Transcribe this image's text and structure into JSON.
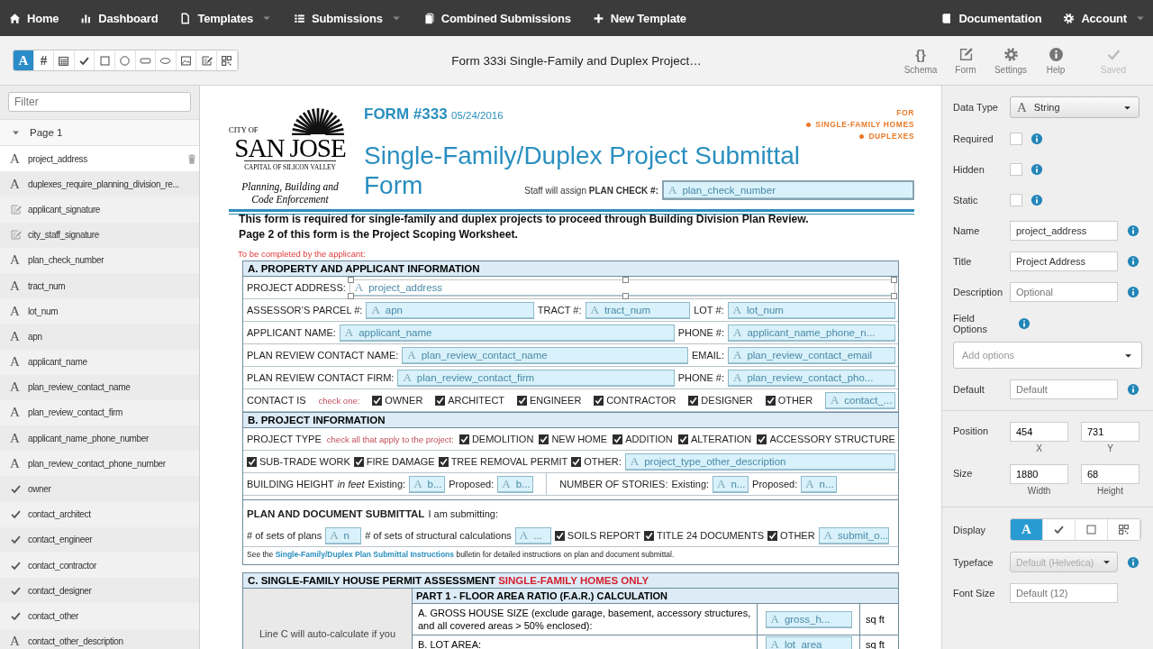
{
  "nav": {
    "left": [
      {
        "label": "Home",
        "has_menu": false
      },
      {
        "label": "Dashboard",
        "has_menu": false
      },
      {
        "label": "Templates",
        "has_menu": true
      },
      {
        "label": "Submissions",
        "has_menu": true
      },
      {
        "label": "Combined Submissions",
        "has_menu": false
      },
      {
        "label": "New Template",
        "has_menu": false
      }
    ],
    "right": [
      {
        "label": "Documentation",
        "has_menu": false
      },
      {
        "label": "Account",
        "has_menu": true
      }
    ]
  },
  "toolbar": {
    "tools": [
      {
        "kind": "glyph",
        "text": "A",
        "selected": true
      },
      {
        "kind": "glyph",
        "text": "#",
        "selected": false
      },
      {
        "kind": "calendar",
        "selected": false
      },
      {
        "kind": "check",
        "selected": false
      },
      {
        "kind": "square",
        "selected": false
      },
      {
        "kind": "circle",
        "selected": false
      },
      {
        "kind": "rounded-rect",
        "selected": false
      },
      {
        "kind": "ellipse",
        "selected": false
      },
      {
        "kind": "image",
        "selected": false
      },
      {
        "kind": "signature",
        "selected": false
      },
      {
        "kind": "qr-code",
        "selected": false
      }
    ],
    "title": "Form 333i Single-Family and Duplex Project…",
    "actions": [
      {
        "kind": "glyph",
        "text": "{}",
        "label": "Schema",
        "disabled": false
      },
      {
        "kind": "edit",
        "label": "Form",
        "disabled": false
      },
      {
        "kind": "gear",
        "label": "Settings",
        "disabled": false
      },
      {
        "kind": "info",
        "label": "Help",
        "disabled": false
      },
      {
        "kind": "check",
        "label": "Saved",
        "disabled": true
      }
    ]
  },
  "sidebar": {
    "filter_placeholder": "Filter",
    "page": {
      "label": "Page 1",
      "expanded": true
    },
    "fields": [
      {
        "kind": "text",
        "glyph": "A",
        "name": "project_address",
        "selected": true
      },
      {
        "kind": "text",
        "glyph": "A",
        "name": "duplexes_require_planning_division_re...",
        "selected": false
      },
      {
        "kind": "signature",
        "name": "applicant_signature",
        "selected": false
      },
      {
        "kind": "signature",
        "name": "city_staff_signature",
        "selected": false
      },
      {
        "kind": "text",
        "glyph": "A",
        "name": "plan_check_number",
        "selected": false
      },
      {
        "kind": "text",
        "glyph": "A",
        "name": "tract_num",
        "selected": false
      },
      {
        "kind": "text",
        "glyph": "A",
        "name": "lot_num",
        "selected": false
      },
      {
        "kind": "text",
        "glyph": "A",
        "name": "apn",
        "selected": false
      },
      {
        "kind": "text",
        "glyph": "A",
        "name": "applicant_name",
        "selected": false
      },
      {
        "kind": "text",
        "glyph": "A",
        "name": "plan_review_contact_name",
        "selected": false
      },
      {
        "kind": "text",
        "glyph": "A",
        "name": "plan_review_contact_firm",
        "selected": false
      },
      {
        "kind": "text",
        "glyph": "A",
        "name": "applicant_name_phone_number",
        "selected": false
      },
      {
        "kind": "text",
        "glyph": "A",
        "name": "plan_review_contact_phone_number",
        "selected": false
      },
      {
        "kind": "check",
        "name": "owner",
        "selected": false
      },
      {
        "kind": "check",
        "name": "contact_architect",
        "selected": false
      },
      {
        "kind": "check",
        "name": "contact_engineer",
        "selected": false
      },
      {
        "kind": "check",
        "name": "contact_contractor",
        "selected": false
      },
      {
        "kind": "check",
        "name": "contact_designer",
        "selected": false
      },
      {
        "kind": "check",
        "name": "contact_other",
        "selected": false
      },
      {
        "kind": "text",
        "glyph": "A",
        "name": "contact_other_description",
        "selected": false
      }
    ]
  },
  "form": {
    "logo": {
      "top": "CITY OF",
      "name": "SAN JOSE",
      "tagline": "CAPITAL OF SILICON VALLEY",
      "dept": "Planning, Building and Code Enforcement"
    },
    "number": "FORM #333",
    "date": "05/24/2016",
    "audience": {
      "heading": "FOR",
      "items": [
        "SINGLE-FAMILY HOMES",
        "DUPLEXES"
      ]
    },
    "title": [
      "Single-Family/Duplex Project Submittal",
      "Form"
    ],
    "plan_check": {
      "prefix": "Staff will assign",
      "label": "PLAN CHECK #:",
      "field": {
        "glyph": "A",
        "text": "plan_check_number",
        "selected": false
      }
    },
    "intro": [
      "This form is required for single-family and duplex projects to proceed through Building Division Plan Review.",
      "Page 2 of this form is the Project Scoping Worksheet."
    ],
    "instruction": "To be completed by the applicant:",
    "sections": [
      {
        "title": "A. PROPERTY AND APPLICANT INFORMATION",
        "rows": [
          {
            "kind": "items",
            "items": [
              {
                "kind": "label",
                "text": "PROJECT ADDRESS:"
              },
              {
                "kind": "field",
                "glyph": "A",
                "text": "project_address",
                "selected": true
              }
            ]
          },
          {
            "kind": "items",
            "items": [
              {
                "kind": "label",
                "text": "ASSESSOR’S PARCEL #:"
              },
              {
                "kind": "field",
                "glyph": "A",
                "text": "apn",
                "selected": false
              },
              {
                "kind": "label",
                "text": "TRACT #:"
              },
              {
                "kind": "mid_field",
                "glyph": "A",
                "text": "tract_num",
                "selected": false
              },
              {
                "kind": "label",
                "text": "LOT #:"
              },
              {
                "kind": "field",
                "glyph": "A",
                "text": "lot_num",
                "selected": false
              }
            ]
          },
          {
            "kind": "items",
            "items": [
              {
                "kind": "label",
                "text": "APPLICANT NAME:"
              },
              {
                "kind": "field",
                "glyph": "A",
                "text": "applicant_name",
                "selected": false
              },
              {
                "kind": "label",
                "text": "PHONE #:"
              },
              {
                "kind": "wide_field",
                "glyph": "A",
                "text": "applicant_name_phone_n...",
                "selected": false
              }
            ]
          },
          {
            "kind": "items",
            "items": [
              {
                "kind": "label",
                "text": "PLAN REVIEW CONTACT NAME:"
              },
              {
                "kind": "field",
                "glyph": "A",
                "text": "plan_review_contact_name",
                "selected": false
              },
              {
                "kind": "label",
                "text": "EMAIL:"
              },
              {
                "kind": "wide_field",
                "glyph": "A",
                "text": "plan_review_contact_email",
                "selected": false
              }
            ]
          },
          {
            "kind": "items",
            "items": [
              {
                "kind": "label",
                "text": "PLAN REVIEW CONTACT FIRM:"
              },
              {
                "kind": "field",
                "glyph": "A",
                "text": "plan_review_contact_firm",
                "selected": false
              },
              {
                "kind": "label",
                "text": "PHONE #:"
              },
              {
                "kind": "wide_field",
                "glyph": "A",
                "text": "plan_review_contact_pho...",
                "selected": false
              }
            ]
          },
          {
            "kind": "spread",
            "items": [
              {
                "kind": "label",
                "text": "CONTACT IS"
              },
              {
                "kind": "hint",
                "text": "check one:"
              },
              {
                "kind": "check",
                "text": "OWNER",
                "checked": true
              },
              {
                "kind": "check",
                "text": "ARCHITECT",
                "checked": true
              },
              {
                "kind": "check",
                "text": "ENGINEER",
                "checked": true
              },
              {
                "kind": "check",
                "text": "CONTRACTOR",
                "checked": true
              },
              {
                "kind": "check",
                "text": "DESIGNER",
                "checked": true
              },
              {
                "kind": "check",
                "text": "OTHER",
                "checked": true
              },
              {
                "kind": "short_field",
                "glyph": "A",
                "text": "contact_...",
                "selected": false
              }
            ]
          }
        ]
      },
      {
        "title": "B. PROJECT INFORMATION",
        "rows": [
          {
            "kind": "spread",
            "items": [
              {
                "kind": "label",
                "text": "PROJECT TYPE"
              },
              {
                "kind": "hint",
                "text": "check all that apply to the project:"
              },
              {
                "kind": "check",
                "text": "DEMOLITION",
                "checked": true
              },
              {
                "kind": "check",
                "text": "NEW HOME",
                "checked": true
              },
              {
                "kind": "check",
                "text": "ADDITION",
                "checked": true
              },
              {
                "kind": "check",
                "text": "ALTERATION",
                "checked": true
              },
              {
                "kind": "check",
                "text": "ACCESSORY STRUCTURE",
                "checked": true
              }
            ]
          },
          {
            "kind": "items",
            "items": [
              {
                "kind": "check",
                "text": "SUB-TRADE WORK",
                "checked": true
              },
              {
                "kind": "check",
                "text": "FIRE DAMAGE",
                "checked": true
              },
              {
                "kind": "check",
                "text": "TREE REMOVAL PERMIT",
                "checked": true
              },
              {
                "kind": "check",
                "text": "OTHER:",
                "checked": true
              },
              {
                "kind": "field",
                "glyph": "A",
                "text": "project_type_other_description",
                "selected": false
              }
            ]
          },
          {
            "kind": "items",
            "items": [
              {
                "kind": "label",
                "text": "BUILDING HEIGHT"
              },
              {
                "kind": "italic",
                "text": "in feet"
              },
              {
                "kind": "label",
                "text": "Existing:"
              },
              {
                "kind": "tiny_field",
                "glyph": "A",
                "text": "b...",
                "selected": false
              },
              {
                "kind": "label",
                "text": "Proposed:"
              },
              {
                "kind": "tiny_field",
                "glyph": "A",
                "text": "b...",
                "selected": false
              },
              {
                "kind": "divider"
              },
              {
                "kind": "label",
                "text": "NUMBER OF STORIES:"
              },
              {
                "kind": "label",
                "text": "Existing:"
              },
              {
                "kind": "tiny_field",
                "glyph": "A",
                "text": "n...",
                "selected": false
              },
              {
                "kind": "label",
                "text": "Proposed:"
              },
              {
                "kind": "tiny_field",
                "glyph": "A",
                "text": "n...",
                "selected": false
              }
            ]
          },
          {
            "kind": "items",
            "items": [
              {
                "kind": "heading",
                "text": "PLAN AND DOCUMENT SUBMITTAL"
              },
              {
                "kind": "plain",
                "text": "I am submitting:"
              }
            ]
          },
          {
            "kind": "items",
            "items": [
              {
                "kind": "plain",
                "text": "# of sets of plans"
              },
              {
                "kind": "tiny_field",
                "glyph": "A",
                "text": "n",
                "selected": false
              },
              {
                "kind": "plain",
                "text": "# of sets of structural calculations"
              },
              {
                "kind": "tiny_field",
                "glyph": "A",
                "text": "...",
                "selected": false
              },
              {
                "kind": "check",
                "text": "SOILS REPORT",
                "checked": true
              },
              {
                "kind": "check",
                "text": "TITLE 24 DOCUMENTS",
                "checked": true
              },
              {
                "kind": "check",
                "text": "OTHER",
                "checked": true
              },
              {
                "kind": "short_field",
                "glyph": "A",
                "text": "submit_o...",
                "selected": false
              }
            ]
          },
          {
            "kind": "note",
            "before": "See the ",
            "link": "Single-Family/Duplex Plan Submittal Instructions",
            "after": " bulletin for detailed instructions on plan and document submittal."
          }
        ]
      }
    ],
    "section_c": {
      "title": "C. SINGLE-FAMILY HOUSE PERMIT ASSESSMENT",
      "note": "SINGLE-FAMILY HOMES ONLY",
      "side_text": "Line C will auto-calculate if you",
      "part_title": "PART 1 - FLOOR AREA RATIO (F.A.R.) CALCULATION",
      "lines": [
        {
          "text": "A. GROSS HOUSE SIZE (exclude garage, basement, accessory structures, and all covered areas > 50% enclosed):",
          "field": {
            "glyph": "A",
            "text": "gross_h...",
            "selected": false
          },
          "unit": "sq ft"
        },
        {
          "text": "B. LOT AREA:",
          "field": {
            "glyph": "A",
            "text": "lot_area",
            "selected": false
          },
          "unit": "sq ft"
        }
      ]
    }
  },
  "properties": {
    "data_type": {
      "label": "Data Type",
      "glyph": "A",
      "value": "String"
    },
    "flags": [
      {
        "label": "Required",
        "checked": false
      },
      {
        "label": "Hidden",
        "checked": false
      },
      {
        "label": "Static",
        "checked": false
      }
    ],
    "inputs": [
      {
        "label": "Name",
        "value": "project_address"
      },
      {
        "label": "Title",
        "value": "Project Address"
      },
      {
        "label": "Description",
        "placeholder": "Optional"
      }
    ],
    "field_options": {
      "label": "Field Options",
      "placeholder": "Add options"
    },
    "default": {
      "label": "Default",
      "placeholder": "Default"
    },
    "position": {
      "label": "Position",
      "x": {
        "value": "454",
        "caption": "X"
      },
      "y": {
        "value": "731",
        "caption": "Y"
      }
    },
    "size": {
      "label": "Size",
      "x": {
        "value": "1880",
        "caption": "Width"
      },
      "y": {
        "value": "68",
        "caption": "Height"
      }
    },
    "display": {
      "label": "Display",
      "options": [
        {
          "kind": "glyph",
          "text": "A",
          "selected": true
        },
        {
          "kind": "check",
          "selected": false
        },
        {
          "kind": "square",
          "selected": false
        },
        {
          "kind": "qr-code",
          "selected": false
        }
      ]
    },
    "typeface": {
      "label": "Typeface",
      "value": "Default (Helvetica)",
      "disabled": true
    },
    "font_size": {
      "label": "Font Size",
      "placeholder": "Default (12)"
    }
  }
}
